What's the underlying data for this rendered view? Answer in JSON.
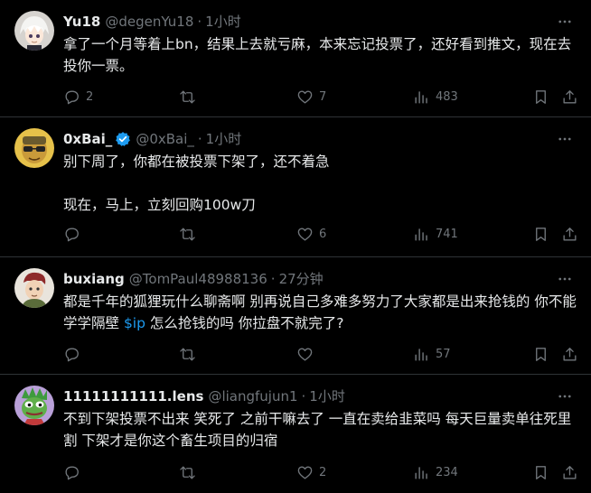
{
  "tweets": [
    {
      "name": "Yu18",
      "handle": "@degenYu18",
      "sep": "·",
      "time": "1小时",
      "verified": false,
      "text_before": "拿了一个月等着上bn，结果上去就亏麻，本来忘记投票了，还好看到推文，现在去投你一票。",
      "tag": "",
      "text_after": "",
      "replies": "2",
      "retweets": "",
      "likes": "7",
      "views": "483",
      "avatar_icon": "anime-avatar"
    },
    {
      "name": "0xBai_",
      "handle": "@0xBai_",
      "sep": "·",
      "time": "1小时",
      "verified": true,
      "text_before": "别下周了，你都在被投票下架了，还不着急\n\n现在，马上，立刻回购100w刀",
      "tag": "",
      "text_after": "",
      "replies": "",
      "retweets": "",
      "likes": "6",
      "views": "741",
      "avatar_icon": "cartoon-avatar"
    },
    {
      "name": "buxiang",
      "handle": "@TomPaul48988136",
      "sep": "·",
      "time": "27分钟",
      "verified": false,
      "text_before": "都是千年的狐狸玩什么聊斋啊 别再说自己多难多努力了大家都是出来抢钱的 你不能学学隔壁 ",
      "tag": "$ip",
      "text_after": " 怎么抢钱的吗 你拉盘不就完了?",
      "replies": "",
      "retweets": "",
      "likes": "",
      "views": "57",
      "avatar_icon": "character-avatar"
    },
    {
      "name": "11111111111.lens",
      "handle": "@liangfujun1",
      "sep": "·",
      "time": "1小时",
      "verified": false,
      "text_before": "不到下架投票不出来 笑死了 之前干嘛去了 一直在卖给韭菜吗 每天巨量卖单往死里割 下架才是你这个畜生项目的归宿",
      "tag": "",
      "text_after": "",
      "replies": "",
      "retweets": "",
      "likes": "2",
      "views": "234",
      "avatar_icon": "pepe-avatar"
    }
  ],
  "colors": {
    "background": "#000000",
    "text": "#e7e9ea",
    "muted": "#71767b",
    "divider": "#2f3336",
    "link": "#1d9bf0",
    "verified": "#1d9bf0"
  },
  "icons": {
    "reply": "reply-icon",
    "retweet": "retweet-icon",
    "like": "like-icon",
    "views": "views-icon",
    "bookmark": "bookmark-icon",
    "share": "share-icon",
    "more": "more-icon",
    "verified": "verified-badge-icon"
  }
}
